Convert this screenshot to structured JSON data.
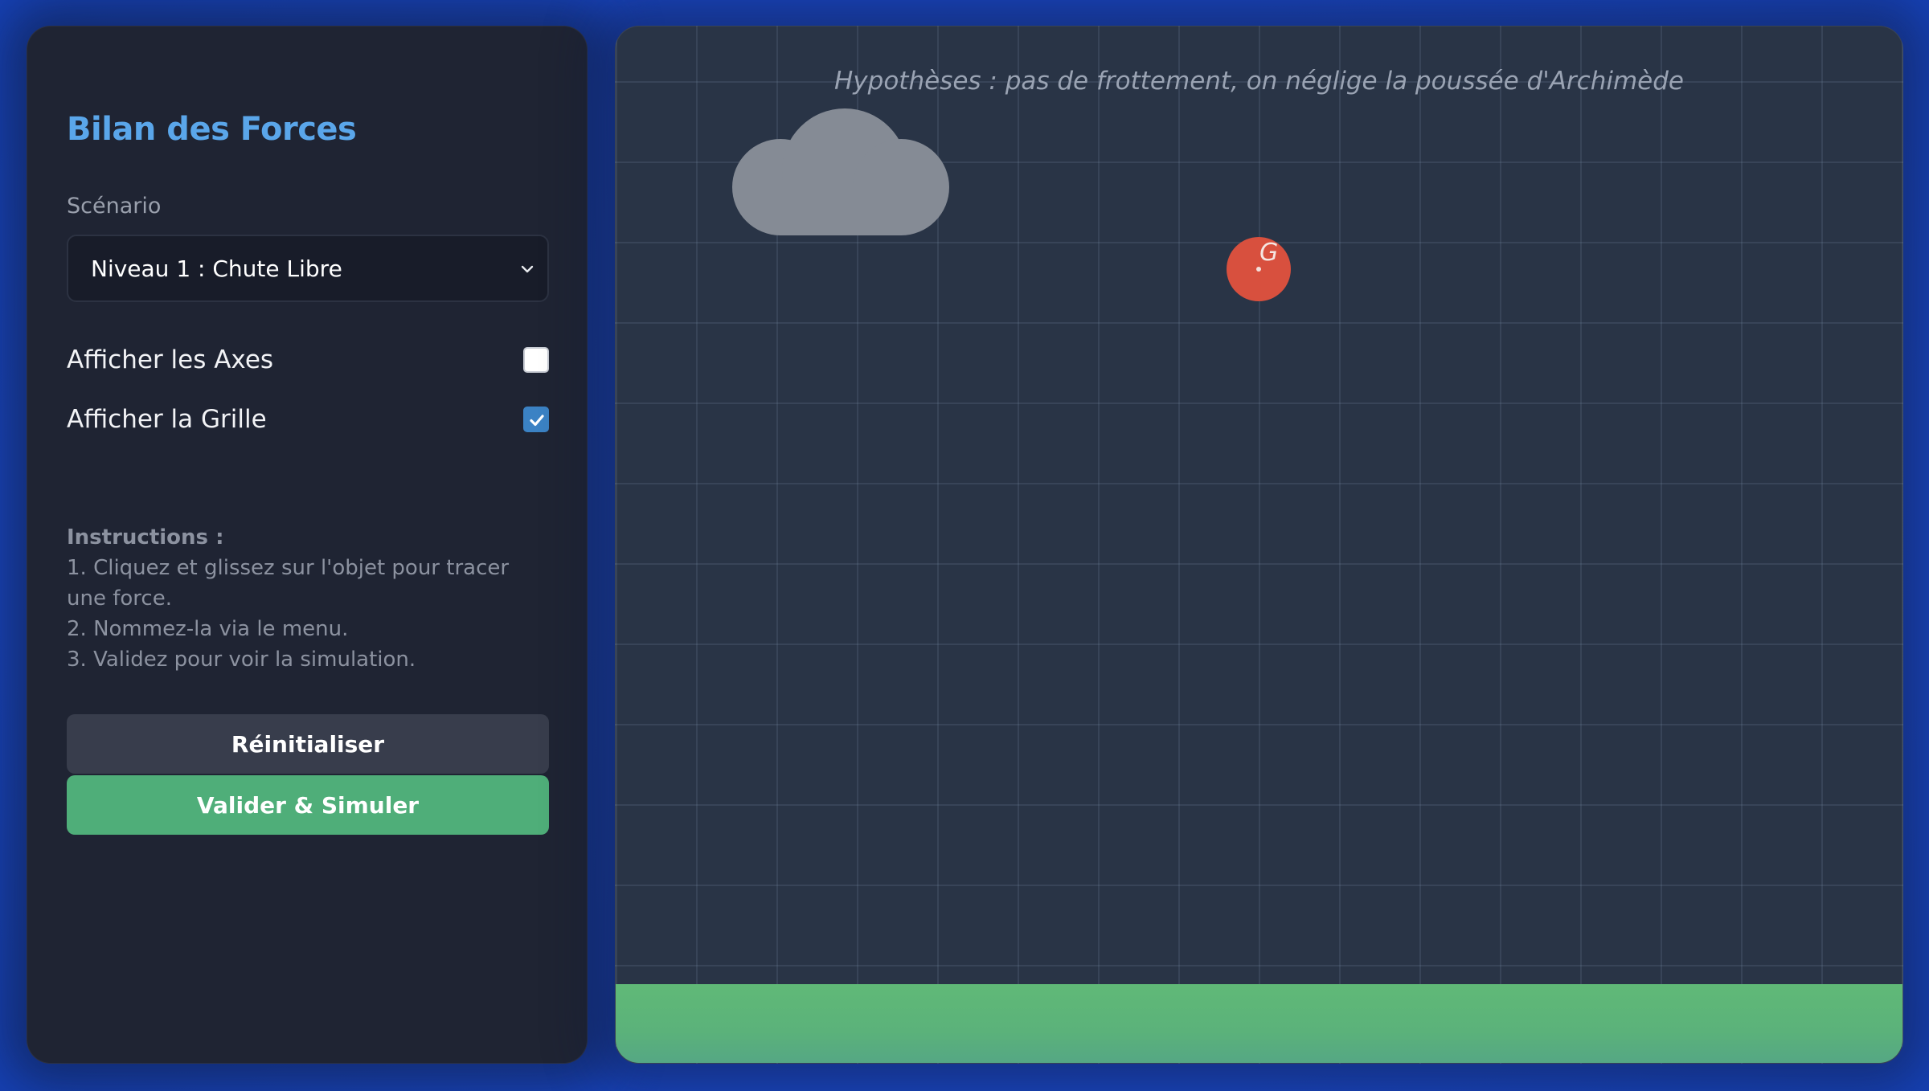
{
  "sidebar": {
    "title": "Bilan des Forces",
    "scenario_label": "Scénario",
    "scenario_select": {
      "value": "Niveau 1 : Chute Libre"
    },
    "options": [
      {
        "label": "Afficher les Axes",
        "checked": false
      },
      {
        "label": "Afficher la Grille",
        "checked": true
      }
    ],
    "instructions": {
      "heading": "Instructions :",
      "steps": [
        "1. Cliquez et glissez sur l'objet pour tracer une force.",
        "2. Nommez-la via le menu.",
        "3. Validez pour voir la simulation."
      ]
    },
    "buttons": {
      "reset": "Réinitialiser",
      "validate": "Valider & Simuler"
    }
  },
  "stage": {
    "hypothesis": "Hypothèses : pas de frottement, on néglige la poussée d'Archimède",
    "object_label": "G",
    "icons": [
      "cloud-icon",
      "ball-object",
      "ground"
    ]
  },
  "colors": {
    "accent": "#5aa6ea",
    "validate": "#4fae79",
    "ball": "#d8503e",
    "ground": "#5bb27a",
    "background": "#1f4fcf"
  }
}
